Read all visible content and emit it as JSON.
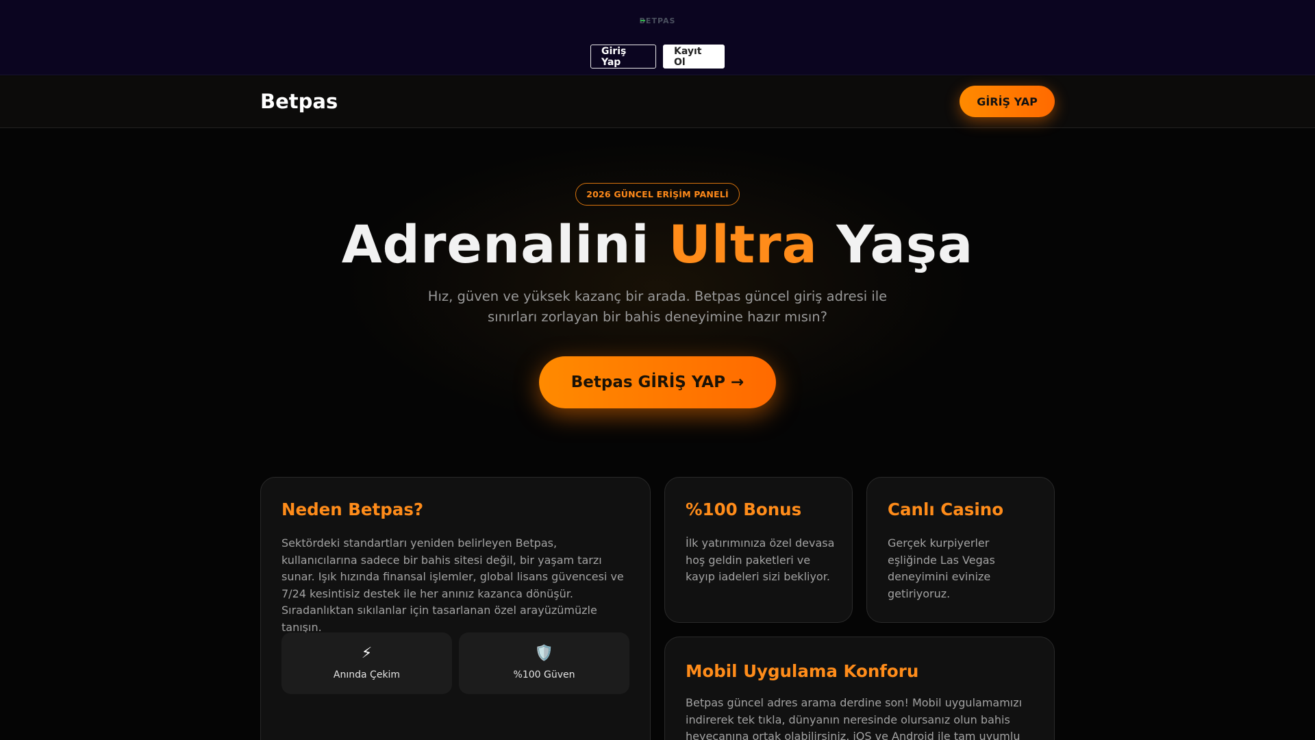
{
  "topbar": {
    "logo_text": "BETPAS",
    "login_label": "Giriş Yap",
    "register_label": "Kayıt Ol"
  },
  "navbar": {
    "brand": "Betpas",
    "cta_label": "GİRİŞ YAP"
  },
  "hero": {
    "badge": "2026 GÜNCEL ERİŞİM PANELİ",
    "title_part1": "Adrenalini ",
    "title_accent": "Ultra",
    "title_part2": " Yaşa",
    "subtitle": "Hız, güven ve yüksek kazanç bir arada. Betpas güncel giriş adresi ile sınırları zorlayan bir bahis deneyimine hazır mısın?",
    "cta_label": "Betpas GİRİŞ YAP →"
  },
  "cards": {
    "why": {
      "title": "Neden Betpas?",
      "text": "Sektördeki standartları yeniden belirleyen Betpas, kullanıcılarına sadece bir bahis sitesi değil, bir yaşam tarzı sunar. Işık hızında finansal işlemler, global lisans güvencesi ve 7/24 kesintisiz destek ile her anınız kazanca dönüşür. Sıradanlıktan sıkılanlar için tasarlanan özel arayüzümüzle tanışın.",
      "features": [
        {
          "icon": "⚡",
          "label": "Anında Çekim"
        },
        {
          "icon": "🛡️",
          "label": "%100 Güven"
        }
      ]
    },
    "bonus": {
      "title": "%100 Bonus",
      "text": "İlk yatırımınıza özel devasa hoş geldin paketleri ve kayıp iadeleri sizi bekliyor."
    },
    "casino": {
      "title": "Canlı Casino",
      "text": "Gerçek kurpiyerler eşliğinde Las Vegas deneyimini evinize getiriyoruz."
    },
    "mobile": {
      "title": "Mobil Uygulama Konforu",
      "text": "Betpas güncel adres arama derdine son! Mobil uygulamamızı indirerek tek tıkla, dünyanın neresinde olursanız olun bahis heyecanına ortak olabilirsiniz. iOS ve Android ile tam uyumlu"
    }
  },
  "colors": {
    "accent": "#ff8c1a",
    "topbar_bg": "#0b0520",
    "page_bg": "#050505",
    "card_bg": "#111111"
  }
}
